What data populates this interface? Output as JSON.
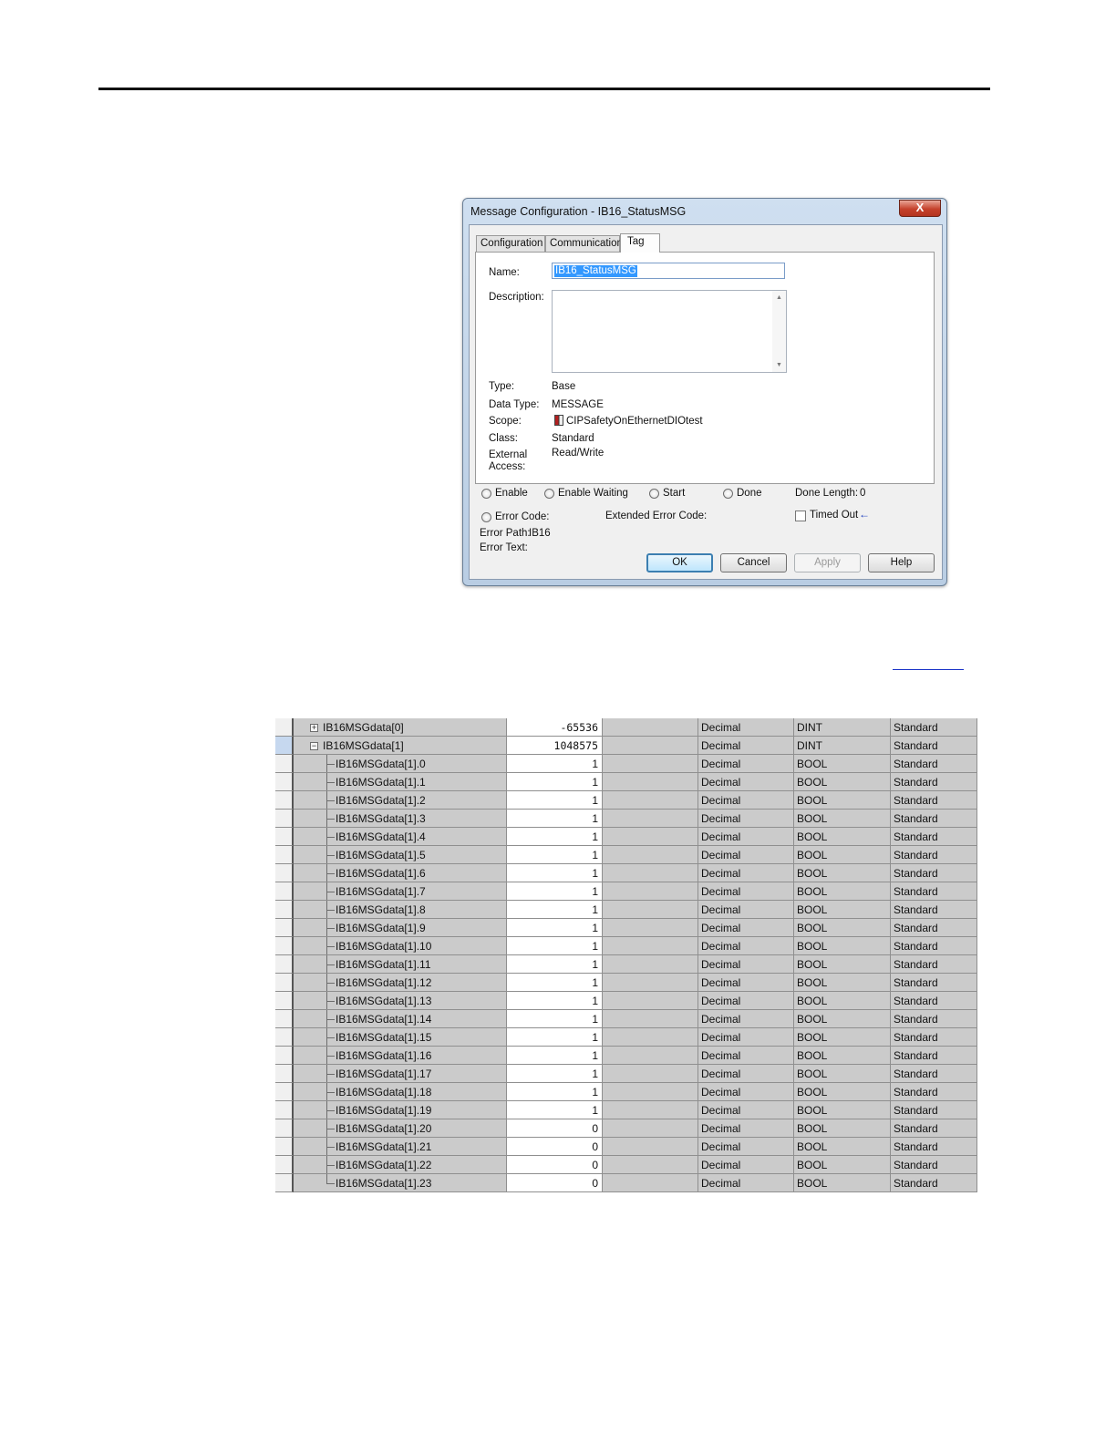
{
  "dialog": {
    "title": "Message Configuration - IB16_StatusMSG",
    "close_label": "X",
    "tabs": [
      {
        "label": "Configuration",
        "active": false
      },
      {
        "label": "Communication",
        "active": false
      },
      {
        "label": "Tag",
        "active": true
      }
    ],
    "fields": {
      "name_label": "Name:",
      "name_value": "IB16_StatusMSG",
      "description_label": "Description:",
      "description_value": "",
      "type_label": "Type:",
      "type_value": "Base",
      "data_type_label": "Data Type:",
      "data_type_value": "MESSAGE",
      "scope_label": "Scope:",
      "scope_value": "CIPSafetyOnEthernetDIOtest",
      "class_label": "Class:",
      "class_value": "Standard",
      "external_access_label_1": "External",
      "external_access_label_2": "Access:",
      "external_access_value": "Read/Write"
    },
    "status": {
      "enable": "Enable",
      "enable_waiting": "Enable Waiting",
      "start": "Start",
      "done": "Done",
      "done_length_label": "Done Length:",
      "done_length_value": "0",
      "error_code": "Error Code:",
      "extended_error_code": "Extended Error Code:",
      "timed_out": "Timed Out",
      "error_path_label": "Error Path:",
      "error_path_value": "IB16",
      "error_text_label": "Error Text:"
    },
    "buttons": {
      "ok": "OK",
      "cancel": "Cancel",
      "apply": "Apply",
      "help": "Help"
    }
  },
  "tag_grid": {
    "rows": [
      {
        "name": "IB16MSGdata[0]",
        "value": "-65536",
        "style": "Decimal",
        "data_type": "DINT",
        "class": "Standard",
        "expander": "+"
      },
      {
        "name": "IB16MSGdata[1]",
        "value": "1048575",
        "style": "Decimal",
        "data_type": "DINT",
        "class": "Standard",
        "expander": "−"
      },
      {
        "name": "IB16MSGdata[1].0",
        "value": "1",
        "style": "Decimal",
        "data_type": "BOOL",
        "class": "Standard"
      },
      {
        "name": "IB16MSGdata[1].1",
        "value": "1",
        "style": "Decimal",
        "data_type": "BOOL",
        "class": "Standard"
      },
      {
        "name": "IB16MSGdata[1].2",
        "value": "1",
        "style": "Decimal",
        "data_type": "BOOL",
        "class": "Standard"
      },
      {
        "name": "IB16MSGdata[1].3",
        "value": "1",
        "style": "Decimal",
        "data_type": "BOOL",
        "class": "Standard"
      },
      {
        "name": "IB16MSGdata[1].4",
        "value": "1",
        "style": "Decimal",
        "data_type": "BOOL",
        "class": "Standard"
      },
      {
        "name": "IB16MSGdata[1].5",
        "value": "1",
        "style": "Decimal",
        "data_type": "BOOL",
        "class": "Standard"
      },
      {
        "name": "IB16MSGdata[1].6",
        "value": "1",
        "style": "Decimal",
        "data_type": "BOOL",
        "class": "Standard"
      },
      {
        "name": "IB16MSGdata[1].7",
        "value": "1",
        "style": "Decimal",
        "data_type": "BOOL",
        "class": "Standard"
      },
      {
        "name": "IB16MSGdata[1].8",
        "value": "1",
        "style": "Decimal",
        "data_type": "BOOL",
        "class": "Standard"
      },
      {
        "name": "IB16MSGdata[1].9",
        "value": "1",
        "style": "Decimal",
        "data_type": "BOOL",
        "class": "Standard"
      },
      {
        "name": "IB16MSGdata[1].10",
        "value": "1",
        "style": "Decimal",
        "data_type": "BOOL",
        "class": "Standard"
      },
      {
        "name": "IB16MSGdata[1].11",
        "value": "1",
        "style": "Decimal",
        "data_type": "BOOL",
        "class": "Standard"
      },
      {
        "name": "IB16MSGdata[1].12",
        "value": "1",
        "style": "Decimal",
        "data_type": "BOOL",
        "class": "Standard"
      },
      {
        "name": "IB16MSGdata[1].13",
        "value": "1",
        "style": "Decimal",
        "data_type": "BOOL",
        "class": "Standard"
      },
      {
        "name": "IB16MSGdata[1].14",
        "value": "1",
        "style": "Decimal",
        "data_type": "BOOL",
        "class": "Standard"
      },
      {
        "name": "IB16MSGdata[1].15",
        "value": "1",
        "style": "Decimal",
        "data_type": "BOOL",
        "class": "Standard"
      },
      {
        "name": "IB16MSGdata[1].16",
        "value": "1",
        "style": "Decimal",
        "data_type": "BOOL",
        "class": "Standard"
      },
      {
        "name": "IB16MSGdata[1].17",
        "value": "1",
        "style": "Decimal",
        "data_type": "BOOL",
        "class": "Standard"
      },
      {
        "name": "IB16MSGdata[1].18",
        "value": "1",
        "style": "Decimal",
        "data_type": "BOOL",
        "class": "Standard"
      },
      {
        "name": "IB16MSGdata[1].19",
        "value": "1",
        "style": "Decimal",
        "data_type": "BOOL",
        "class": "Standard"
      },
      {
        "name": "IB16MSGdata[1].20",
        "value": "0",
        "style": "Decimal",
        "data_type": "BOOL",
        "class": "Standard"
      },
      {
        "name": "IB16MSGdata[1].21",
        "value": "0",
        "style": "Decimal",
        "data_type": "BOOL",
        "class": "Standard"
      },
      {
        "name": "IB16MSGdata[1].22",
        "value": "0",
        "style": "Decimal",
        "data_type": "BOOL",
        "class": "Standard"
      },
      {
        "name": "IB16MSGdata[1].23",
        "value": "0",
        "style": "Decimal",
        "data_type": "BOOL",
        "class": "Standard"
      }
    ]
  },
  "colors": {
    "selection": "#3398ff",
    "grid_readonly": "#cbcbcb",
    "link": "#1a33c8"
  }
}
